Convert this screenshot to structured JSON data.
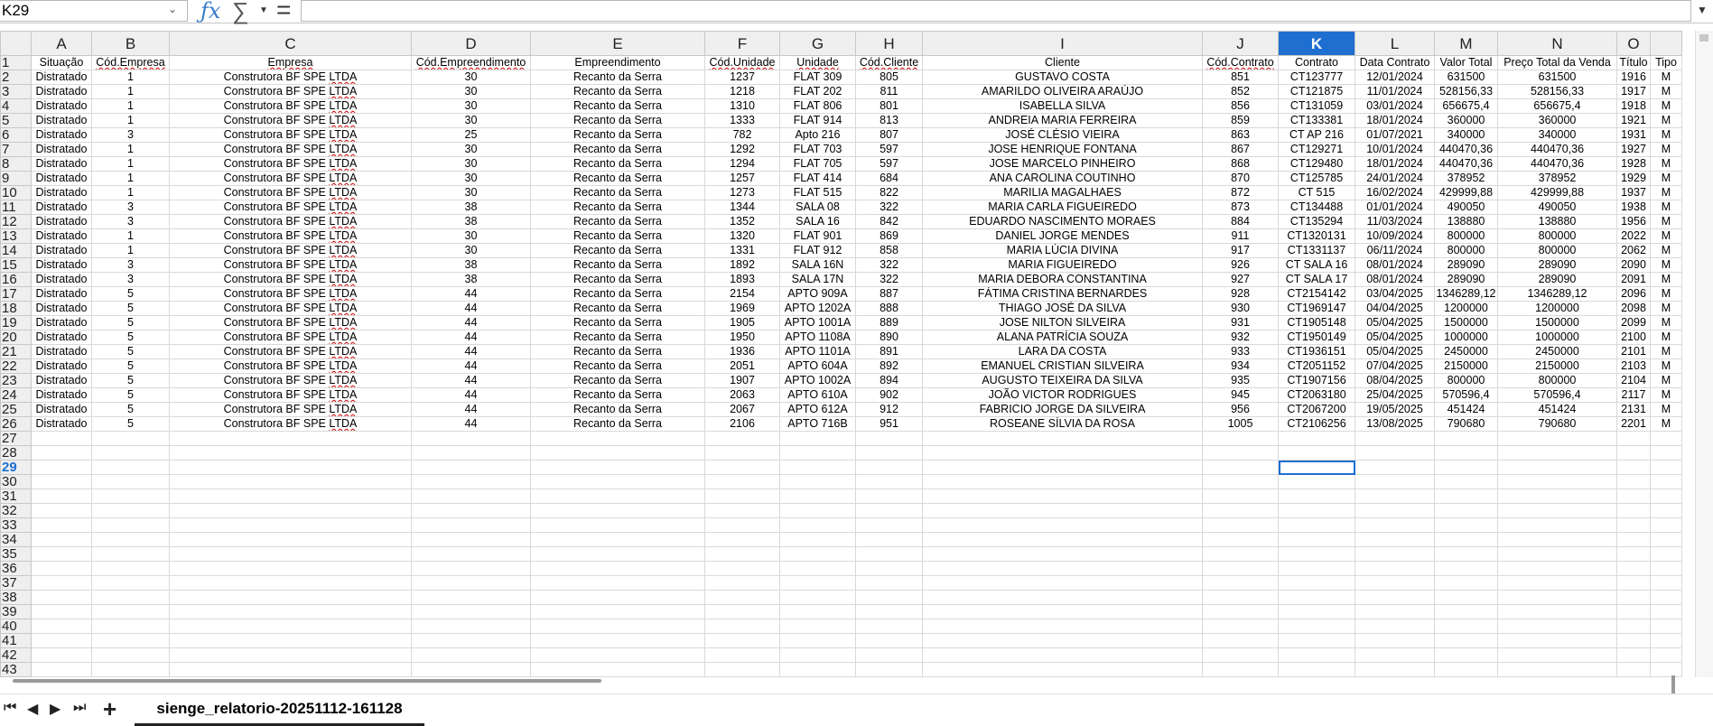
{
  "formula_bar": {
    "name_box": "K29",
    "fx_icon": "ƒx",
    "sum_icon": "∑",
    "equals_icon": "=",
    "formula_value": ""
  },
  "sheet": {
    "selected_cell": "K29",
    "selected_column": "K",
    "selected_row": 29,
    "columns": [
      "A",
      "B",
      "C",
      "D",
      "E",
      "F",
      "G",
      "H",
      "I",
      "J",
      "K",
      "L",
      "M",
      "N",
      "O",
      ""
    ],
    "headers": [
      "Situação",
      "Cód.Empresa",
      "Empresa",
      "Cód.Empreendimento",
      "Empreendimento",
      "Cód.Unidade",
      "Unidade",
      "Cód.Cliente",
      "Cliente",
      "Cód.Contrato",
      "Contrato",
      "Data Contrato",
      "Valor Total",
      "Preço Total da Venda",
      "Título",
      "Tipo"
    ],
    "rows": [
      [
        "Distratado",
        "1",
        "Construtora BF SPE LTDA",
        "30",
        "Recanto da Serra",
        "1237",
        "FLAT 309",
        "805",
        "GUSTAVO COSTA",
        "851",
        "CT123777",
        "12/01/2024",
        "631500",
        "631500",
        "1916",
        "M"
      ],
      [
        "Distratado",
        "1",
        "Construtora BF SPE LTDA",
        "30",
        "Recanto da Serra",
        "1218",
        "FLAT 202",
        "811",
        "AMARILDO OLIVEIRA ARAÚJO",
        "852",
        "CT121875",
        "11/01/2024",
        "528156,33",
        "528156,33",
        "1917",
        "M"
      ],
      [
        "Distratado",
        "1",
        "Construtora BF SPE LTDA",
        "30",
        "Recanto da Serra",
        "1310",
        "FLAT 806",
        "801",
        "ISABELLA SILVA",
        "856",
        "CT131059",
        "03/01/2024",
        "656675,4",
        "656675,4",
        "1918",
        "M"
      ],
      [
        "Distratado",
        "1",
        "Construtora BF SPE LTDA",
        "30",
        "Recanto da Serra",
        "1333",
        "FLAT 914",
        "813",
        "ANDREIA MARIA FERREIRA",
        "859",
        "CT133381",
        "18/01/2024",
        "360000",
        "360000",
        "1921",
        "M"
      ],
      [
        "Distratado",
        "3",
        "Construtora BF SPE LTDA",
        "25",
        "Recanto da Serra",
        "782",
        "Apto 216",
        "807",
        "JOSÉ CLÉSIO VIEIRA",
        "863",
        "CT AP 216",
        "01/07/2021",
        "340000",
        "340000",
        "1931",
        "M"
      ],
      [
        "Distratado",
        "1",
        "Construtora BF SPE LTDA",
        "30",
        "Recanto da Serra",
        "1292",
        "FLAT 703",
        "597",
        "JOSE HENRIQUE FONTANA",
        "867",
        "CT129271",
        "10/01/2024",
        "440470,36",
        "440470,36",
        "1927",
        "M"
      ],
      [
        "Distratado",
        "1",
        "Construtora BF SPE LTDA",
        "30",
        "Recanto da Serra",
        "1294",
        "FLAT 705",
        "597",
        "JOSE MARCELO PINHEIRO",
        "868",
        "CT129480",
        "18/01/2024",
        "440470,36",
        "440470,36",
        "1928",
        "M"
      ],
      [
        "Distratado",
        "1",
        "Construtora BF SPE LTDA",
        "30",
        "Recanto da Serra",
        "1257",
        "FLAT 414",
        "684",
        "ANA CAROLINA COUTINHO",
        "870",
        "CT125785",
        "24/01/2024",
        "378952",
        "378952",
        "1929",
        "M"
      ],
      [
        "Distratado",
        "1",
        "Construtora BF SPE LTDA",
        "30",
        "Recanto da Serra",
        "1273",
        "FLAT 515",
        "822",
        "MARILIA MAGALHAES",
        "872",
        "CT 515",
        "16/02/2024",
        "429999,88",
        "429999,88",
        "1937",
        "M"
      ],
      [
        "Distratado",
        "3",
        "Construtora BF SPE LTDA",
        "38",
        "Recanto da Serra",
        "1344",
        "SALA 08",
        "322",
        "MARIA CARLA  FIGUEIREDO",
        "873",
        "CT134488",
        "01/01/2024",
        "490050",
        "490050",
        "1938",
        "M"
      ],
      [
        "Distratado",
        "3",
        "Construtora BF SPE LTDA",
        "38",
        "Recanto da Serra",
        "1352",
        "SALA 16",
        "842",
        "EDUARDO NASCIMENTO MORAES",
        "884",
        "CT135294",
        "11/03/2024",
        "138880",
        "138880",
        "1956",
        "M"
      ],
      [
        "Distratado",
        "1",
        "Construtora BF SPE LTDA",
        "30",
        "Recanto da Serra",
        "1320",
        "FLAT 901",
        "869",
        "DANIEL JORGE MENDES",
        "911",
        "CT1320131",
        "10/09/2024",
        "800000",
        "800000",
        "2022",
        "M"
      ],
      [
        "Distratado",
        "1",
        "Construtora BF SPE LTDA",
        "30",
        "Recanto da Serra",
        "1331",
        "FLAT 912",
        "858",
        "MARIA LÚCIA DIVINA",
        "917",
        "CT1331137",
        "06/11/2024",
        "800000",
        "800000",
        "2062",
        "M"
      ],
      [
        "Distratado",
        "3",
        "Construtora BF SPE LTDA",
        "38",
        "Recanto da Serra",
        "1892",
        "SALA 16N",
        "322",
        "MARIA  FIGUEIREDO",
        "926",
        "CT SALA 16",
        "08/01/2024",
        "289090",
        "289090",
        "2090",
        "M"
      ],
      [
        "Distratado",
        "3",
        "Construtora BF SPE LTDA",
        "38",
        "Recanto da Serra",
        "1893",
        "SALA 17N",
        "322",
        "MARIA DEBORA CONSTANTINA",
        "927",
        "CT SALA 17",
        "08/01/2024",
        "289090",
        "289090",
        "2091",
        "M"
      ],
      [
        "Distratado",
        "5",
        "Construtora BF SPE LTDA",
        "44",
        "Recanto da Serra",
        "2154",
        "APTO 909A",
        "887",
        "FÁTIMA CRISTINA BERNARDES",
        "928",
        "CT2154142",
        "03/04/2025",
        "1346289,12",
        "1346289,12",
        "2096",
        "M"
      ],
      [
        "Distratado",
        "5",
        "Construtora BF SPE LTDA",
        "44",
        "Recanto da Serra",
        "1969",
        "APTO 1202A",
        "888",
        "THIAGO JOSÉ DA SILVA",
        "930",
        "CT1969147",
        "04/04/2025",
        "1200000",
        "1200000",
        "2098",
        "M"
      ],
      [
        "Distratado",
        "5",
        "Construtora BF SPE LTDA",
        "44",
        "Recanto da Serra",
        "1905",
        "APTO 1001A",
        "889",
        "JOSE NILTON SILVEIRA",
        "931",
        "CT1905148",
        "05/04/2025",
        "1500000",
        "1500000",
        "2099",
        "M"
      ],
      [
        "Distratado",
        "5",
        "Construtora BF SPE LTDA",
        "44",
        "Recanto da Serra",
        "1950",
        "APTO 1108A",
        "890",
        "ALANA PATRÍCIA SOUZA",
        "932",
        "CT1950149",
        "05/04/2025",
        "1000000",
        "1000000",
        "2100",
        "M"
      ],
      [
        "Distratado",
        "5",
        "Construtora BF SPE LTDA",
        "44",
        "Recanto da Serra",
        "1936",
        "APTO 1101A",
        "891",
        "LARA DA COSTA",
        "933",
        "CT1936151",
        "05/04/2025",
        "2450000",
        "2450000",
        "2101",
        "M"
      ],
      [
        "Distratado",
        "5",
        "Construtora BF SPE LTDA",
        "44",
        "Recanto da Serra",
        "2051",
        "APTO 604A",
        "892",
        "EMANUEL CRISTIAN SILVEIRA",
        "934",
        "CT2051152",
        "07/04/2025",
        "2150000",
        "2150000",
        "2103",
        "M"
      ],
      [
        "Distratado",
        "5",
        "Construtora BF SPE LTDA",
        "44",
        "Recanto da Serra",
        "1907",
        "APTO 1002A",
        "894",
        "AUGUSTO TEIXEIRA DA SILVA",
        "935",
        "CT1907156",
        "08/04/2025",
        "800000",
        "800000",
        "2104",
        "M"
      ],
      [
        "Distratado",
        "5",
        "Construtora BF SPE LTDA",
        "44",
        "Recanto da Serra",
        "2063",
        "APTO 610A",
        "902",
        "JOÃO VICTOR RODRIGUES",
        "945",
        "CT2063180",
        "25/04/2025",
        "570596,4",
        "570596,4",
        "2117",
        "M"
      ],
      [
        "Distratado",
        "5",
        "Construtora BF SPE LTDA",
        "44",
        "Recanto da Serra",
        "2067",
        "APTO 612A",
        "912",
        "FABRICIO JORGE DA SILVEIRA",
        "956",
        "CT2067200",
        "19/05/2025",
        "451424",
        "451424",
        "2131",
        "M"
      ],
      [
        "Distratado",
        "5",
        "Construtora BF SPE LTDA",
        "44",
        "Recanto da Serra",
        "2106",
        "APTO 716B",
        "951",
        "ROSEANE SÍLVIA DA ROSA",
        "1005",
        "CT2106256",
        "13/08/2025",
        "790680",
        "790680",
        "2201",
        "M"
      ]
    ],
    "row_numbers": [
      1,
      2,
      3,
      4,
      5,
      6,
      7,
      8,
      9,
      10,
      11,
      12,
      13,
      14,
      15,
      16,
      17,
      18,
      19,
      20,
      21,
      22,
      23,
      24,
      25,
      26,
      27,
      28,
      29,
      30,
      31,
      32,
      33,
      34,
      35,
      36,
      37,
      38,
      39,
      40,
      41,
      42,
      43
    ]
  },
  "tabs": {
    "nav_first": "⏮",
    "nav_prev": "◀",
    "nav_next": "▶",
    "nav_last": "⏭",
    "add_sheet": "+",
    "active_sheet": "sienge_relatorio-20251112-161128"
  },
  "colors": {
    "accent": "#1f6fd1",
    "header_bg": "#efefef",
    "grid_line": "#d9d9d9"
  }
}
